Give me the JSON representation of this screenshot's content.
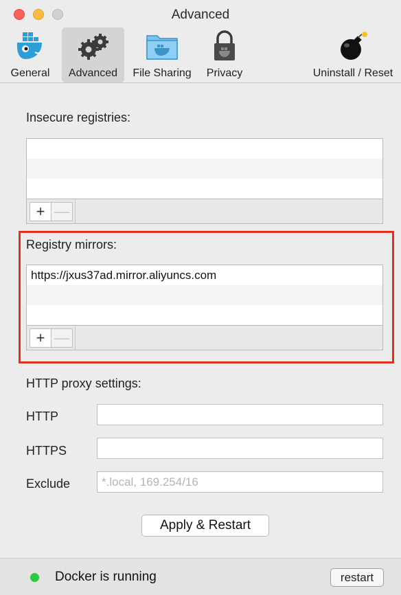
{
  "window": {
    "title": "Advanced"
  },
  "toolbar": {
    "items": [
      {
        "label": "General",
        "icon": "docker-whale-icon",
        "selected": false
      },
      {
        "label": "Advanced",
        "icon": "gears-icon",
        "selected": true
      },
      {
        "label": "File Sharing",
        "icon": "folder-icon",
        "selected": false
      },
      {
        "label": "Privacy",
        "icon": "lock-icon",
        "selected": false
      },
      {
        "label": "Uninstall / Reset",
        "icon": "bomb-icon",
        "selected": false
      }
    ]
  },
  "insecure_registries": {
    "label": "Insecure registries:",
    "rows": [
      "",
      "",
      ""
    ],
    "add_label": "+",
    "remove_label": "—"
  },
  "registry_mirrors": {
    "label": "Registry mirrors:",
    "rows": [
      "https://jxus37ad.mirror.aliyuncs.com",
      "",
      ""
    ],
    "add_label": "+",
    "remove_label": "—",
    "highlight_color": "#e3301f"
  },
  "proxy": {
    "label": "HTTP proxy settings:",
    "http": {
      "label": "HTTP",
      "value": ""
    },
    "https": {
      "label": "HTTPS",
      "value": ""
    },
    "exclude": {
      "label": "Exclude",
      "value": "",
      "placeholder": "*.local, 169.254/16"
    }
  },
  "apply_button": "Apply & Restart",
  "status": {
    "text": "Docker is running",
    "color": "#2fc840",
    "restart_label": "restart"
  }
}
